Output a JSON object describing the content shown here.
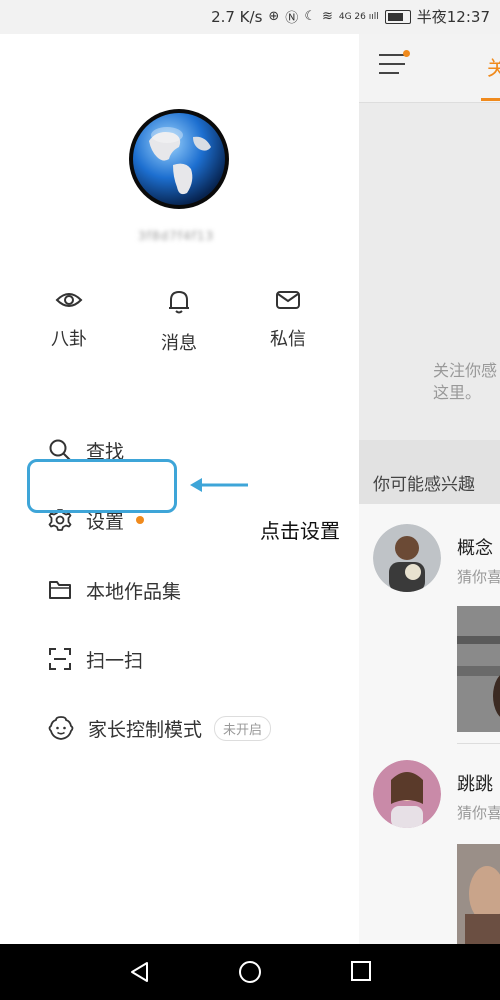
{
  "status_bar": {
    "net_speed": "2.7 K/s",
    "signal": "4G 26 ııll",
    "time": "半夜12:37"
  },
  "drawer": {
    "username": "3f8d7f4f13",
    "quick_actions": [
      {
        "icon": "eye-icon",
        "label": "八卦"
      },
      {
        "icon": "bell-icon",
        "label": "消息"
      },
      {
        "icon": "mail-icon",
        "label": "私信"
      }
    ],
    "menu": [
      {
        "icon": "search-icon",
        "label": "查找"
      },
      {
        "icon": "gear-icon",
        "label": "设置",
        "has_dot": true
      },
      {
        "icon": "folder-icon",
        "label": "本地作品集"
      },
      {
        "icon": "scan-icon",
        "label": "扫一扫"
      },
      {
        "icon": "child-face-icon",
        "label": "家长控制模式",
        "badge": "未开启"
      }
    ]
  },
  "annotation": {
    "text": "点击设置",
    "highlight_color": "#3ea5d8"
  },
  "right_panel": {
    "tab": "关",
    "follow_hint_line1": "关注你感",
    "follow_hint_line2": "这里。",
    "interest_title": "你可能感兴趣",
    "cards": [
      {
        "name": "概念",
        "sub": "猜你喜"
      },
      {
        "name": "跳跳",
        "sub": "猜你喜"
      }
    ]
  },
  "colors": {
    "accent": "#f08a1c",
    "highlight": "#3ea5d8"
  }
}
